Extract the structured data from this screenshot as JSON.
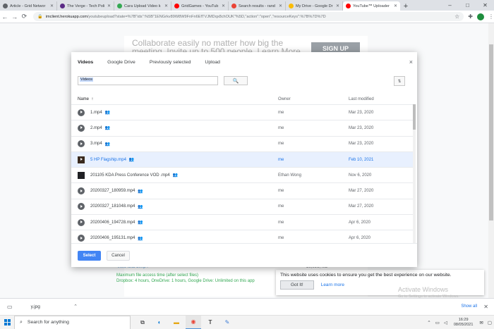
{
  "browser": {
    "tabs": [
      {
        "title": "Article - Grid Networ",
        "favicon_color": "#5f6368",
        "active": false
      },
      {
        "title": "The Verge - Tech Poli",
        "favicon_color": "#5b2a86",
        "active": false
      },
      {
        "title": "Cara Upload Video k",
        "favicon_color": "#34a853",
        "active": false
      },
      {
        "title": "GridGames - YouTub",
        "favicon_color": "#ff0000",
        "active": false
      },
      {
        "title": "Search results - rand",
        "favicon_color": "#ea4335",
        "active": false
      },
      {
        "title": "My Drive - Google Dr",
        "favicon_color": "#fbbc04",
        "active": false
      },
      {
        "title": "YouTube™ Uploader",
        "favicon_color": "#ff0000",
        "active": true
      }
    ],
    "new_tab": "+",
    "window_controls": {
      "minimize": "–",
      "maximize": "□",
      "close": "✕"
    },
    "url_host": "imclient.herokuapp.com",
    "url_path": "/youtubeupload?state=%7B\"ids\":%5B\"1ENGrkv89W8W9FnFn6EfTVJMDqx8chOUK\"%5D,\"action\":\"open\",\"resourceKeys\":%7B%7D%7D"
  },
  "page": {
    "promo_text": "Collaborate easily no matter how big the meeting. Invite up to 500 people. Learn More",
    "signup_label": "SIGN UP",
    "bg_file_name": "View  twtb  2.mp4",
    "bg_file_size": "50,096,402",
    "access_line1": "Maximum file access time (after select files)",
    "access_line2": "Dropbox: 4 hours, OneDrive: 1 hours, Google Drive: Unlimited on this app"
  },
  "picker": {
    "tabs": [
      {
        "label": "Videos",
        "active": true
      },
      {
        "label": "Google Drive",
        "active": false
      },
      {
        "label": "Previously selected",
        "active": false
      },
      {
        "label": "Upload",
        "active": false
      }
    ],
    "close_label": "×",
    "search_value": "Videos",
    "columns": {
      "name": "Name",
      "sort_arrow": "↑",
      "owner": "Owner",
      "modified": "Last modified"
    },
    "files": [
      {
        "name": "1.mp4",
        "shared": true,
        "owner": "me",
        "modified": "Mar 23, 2020",
        "thumb": "play",
        "selected": false
      },
      {
        "name": "2.mp4",
        "shared": true,
        "owner": "me",
        "modified": "Mar 23, 2020",
        "thumb": "play",
        "selected": false
      },
      {
        "name": "3.mp4",
        "shared": true,
        "owner": "me",
        "modified": "Mar 23, 2020",
        "thumb": "play",
        "selected": false
      },
      {
        "name": "5 HP Flagship.mp4",
        "shared": true,
        "owner": "me",
        "modified": "Feb 10, 2021",
        "thumb": "image",
        "selected": true
      },
      {
        "name": "201105 KDA Press Conference VOD .mp4",
        "shared": true,
        "owner": "Ethan Wong",
        "modified": "Nov 6, 2020",
        "thumb": "doc",
        "selected": false
      },
      {
        "name": "20200327_180959.mp4",
        "shared": true,
        "owner": "me",
        "modified": "Mar 27, 2020",
        "thumb": "play",
        "selected": false
      },
      {
        "name": "20200327_181048.mp4",
        "shared": true,
        "owner": "me",
        "modified": "Mar 27, 2020",
        "thumb": "play",
        "selected": false
      },
      {
        "name": "20200406_194728.mp4",
        "shared": true,
        "owner": "me",
        "modified": "Apr 6, 2020",
        "thumb": "play",
        "selected": false
      },
      {
        "name": "20200406_195131.mp4",
        "shared": true,
        "owner": "me",
        "modified": "Apr 6, 2020",
        "thumb": "play",
        "selected": false
      }
    ],
    "select_label": "Select",
    "cancel_label": "Cancel"
  },
  "cookie": {
    "message": "This website uses cookies to ensure you get the best experience on our website.",
    "got_it": "Got It!",
    "learn_more": "Learn more"
  },
  "watermark": {
    "title": "Activate Windows",
    "subtitle": "Go to Settings to activate Windows."
  },
  "downloads": {
    "file_name": "y.jpg",
    "show_all": "Show all",
    "close": "✕"
  },
  "taskbar": {
    "search_placeholder": "Search for anything",
    "time": "16:29",
    "date": "08/05/2021"
  },
  "colors": {
    "accent": "#1a73e8",
    "select_button": "#4285f4",
    "selected_row": "#e8f0fe"
  }
}
